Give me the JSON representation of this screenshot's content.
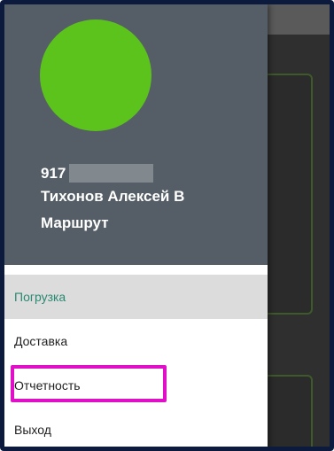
{
  "header": {
    "phone_prefix": "917",
    "user_name": "Тихонов Алексей В",
    "route_label": "Маршрут",
    "avatar_color": "#5cc21c"
  },
  "menu": {
    "items": [
      {
        "label": "Погрузка",
        "active": true
      },
      {
        "label": "Доставка",
        "active": false
      },
      {
        "label": "Отчетность",
        "active": false,
        "highlighted": true
      },
      {
        "label": "Выход",
        "active": false
      }
    ]
  },
  "colors": {
    "header_bg": "#555e66",
    "active_text": "#2a8a72",
    "highlight_border": "#e010c8"
  }
}
